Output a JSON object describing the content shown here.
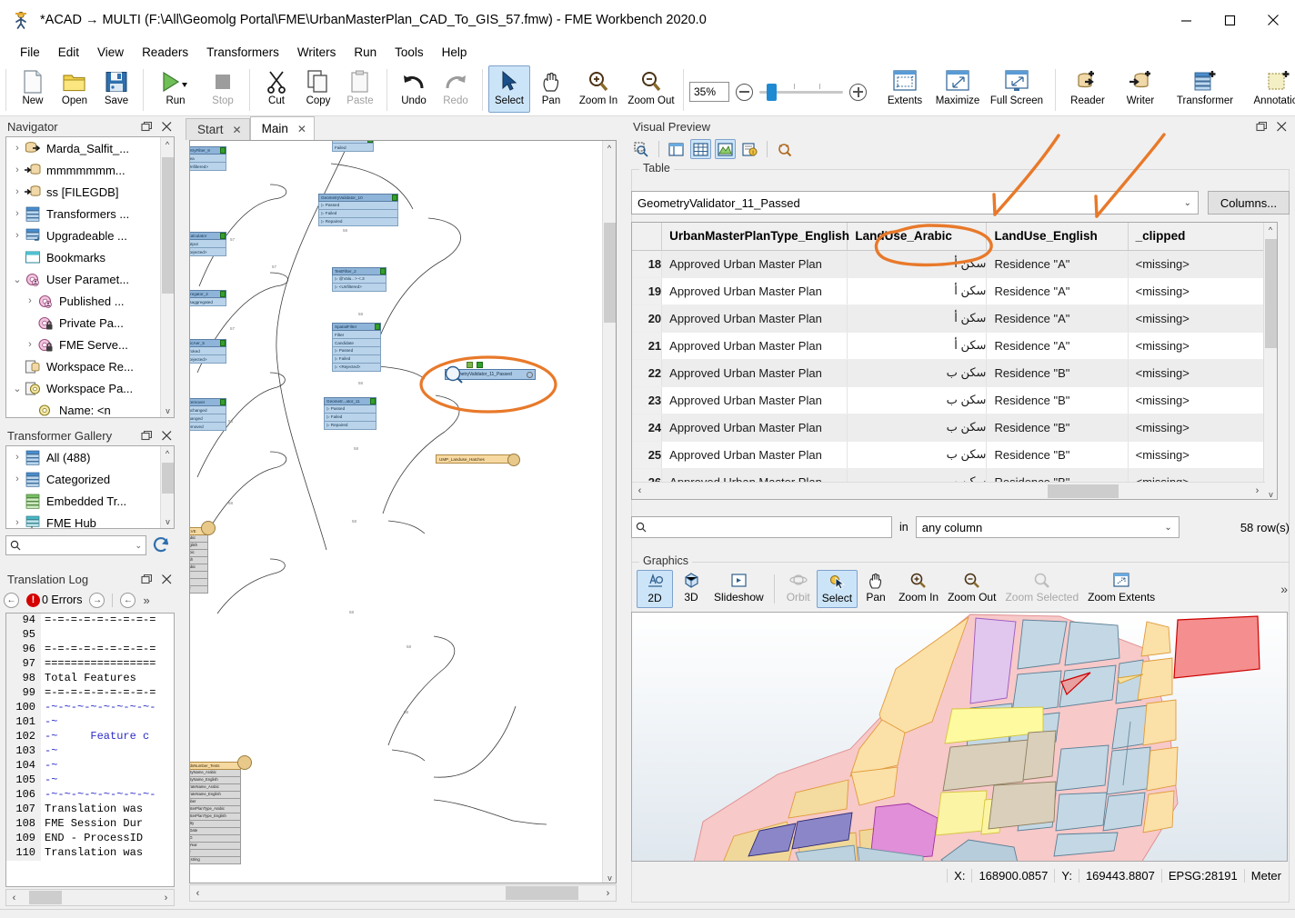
{
  "window": {
    "title": "*ACAD → MULTI (F:\\All\\Geomolg Portal\\FME\\UrbanMasterPlan_CAD_To_GIS_57.fmw) - FME Workbench 2020.0",
    "app_icon": "fme-logo-icon",
    "minimize": "—",
    "maximize": "☐",
    "close": "✕"
  },
  "menu": [
    "File",
    "Edit",
    "View",
    "Readers",
    "Transformers",
    "Writers",
    "Run",
    "Tools",
    "Help"
  ],
  "toolbar": {
    "buttons": [
      {
        "label": "New",
        "icon": "new-document-icon",
        "enabled": true
      },
      {
        "label": "Open",
        "icon": "open-folder-icon",
        "enabled": true
      },
      {
        "label": "Save",
        "icon": "save-disk-icon",
        "enabled": true
      },
      {
        "label": "Run",
        "icon": "run-play-icon",
        "enabled": true
      },
      {
        "label": "Stop",
        "icon": "stop-square-icon",
        "enabled": false
      },
      {
        "label": "Cut",
        "icon": "scissors-icon",
        "enabled": true
      },
      {
        "label": "Copy",
        "icon": "copy-icon",
        "enabled": true
      },
      {
        "label": "Paste",
        "icon": "clipboard-icon",
        "enabled": false
      },
      {
        "label": "Undo",
        "icon": "undo-arrow-icon",
        "enabled": true
      },
      {
        "label": "Redo",
        "icon": "redo-arrow-icon",
        "enabled": false
      },
      {
        "label": "Select",
        "icon": "cursor-arrow-icon",
        "enabled": true,
        "active": true
      },
      {
        "label": "Pan",
        "icon": "hand-icon",
        "enabled": true
      },
      {
        "label": "Zoom In",
        "icon": "zoom-in-icon",
        "enabled": true
      },
      {
        "label": "Zoom Out",
        "icon": "zoom-out-icon",
        "enabled": true
      }
    ],
    "zoom_value": "35%",
    "view_buttons": [
      {
        "label": "Extents",
        "icon": "extents-icon"
      },
      {
        "label": "Maximize",
        "icon": "maximize-view-icon"
      },
      {
        "label": "Full Screen",
        "icon": "full-screen-icon"
      }
    ],
    "add_buttons": [
      {
        "label": "Reader",
        "icon": "add-reader-icon"
      },
      {
        "label": "Writer",
        "icon": "add-writer-icon"
      },
      {
        "label": "Transformer",
        "icon": "add-transformer-icon"
      },
      {
        "label": "Annotation",
        "icon": "add-annotation-icon"
      }
    ],
    "overflow": "»"
  },
  "navigator": {
    "title": "Navigator",
    "float_icon": "float-panel-icon",
    "close_icon": "close-icon",
    "items": [
      {
        "label": "Marda_Salfit_...",
        "icon": "reader-db-icon",
        "expander": ">",
        "indent": 0
      },
      {
        "label": "mmmmmmm...",
        "icon": "writer-db-icon",
        "expander": ">",
        "indent": 0
      },
      {
        "label": "ss [FILEGDB]",
        "icon": "writer-db-icon",
        "expander": ">",
        "indent": 0
      },
      {
        "label": "Transformers ...",
        "icon": "transformer-icon",
        "expander": ">",
        "indent": 0
      },
      {
        "label": "Upgradeable ...",
        "icon": "upgradeable-icon",
        "expander": ">",
        "indent": 0
      },
      {
        "label": "Bookmarks",
        "icon": "bookmark-icon",
        "expander": "",
        "indent": 0
      },
      {
        "label": "User Paramet...",
        "icon": "user-parameter-icon",
        "expander": "v",
        "indent": 0
      },
      {
        "label": "Published ...",
        "icon": "published-parameter-icon",
        "expander": ">",
        "indent": 1
      },
      {
        "label": "Private Pa...",
        "icon": "private-parameter-icon",
        "expander": "",
        "indent": 1
      },
      {
        "label": "FME Serve...",
        "icon": "fme-server-parameter-icon",
        "expander": ">",
        "indent": 1
      },
      {
        "label": "Workspace Re...",
        "icon": "workspace-resources-icon",
        "expander": "",
        "indent": 0
      },
      {
        "label": "Workspace Pa...",
        "icon": "workspace-parameters-icon",
        "expander": "v",
        "indent": 0
      },
      {
        "label": "Name: <n",
        "icon": "parameter-icon",
        "expander": "",
        "indent": 1
      }
    ]
  },
  "gallery": {
    "title": "Transformer Gallery",
    "items": [
      {
        "label": "All (488)",
        "icon": "transformer-icon",
        "expander": ">"
      },
      {
        "label": "Categorized",
        "icon": "transformer-icon",
        "expander": ">"
      },
      {
        "label": "Embedded Tr...",
        "icon": "embedded-transformer-icon",
        "expander": ""
      },
      {
        "label": "FME Hub",
        "icon": "fme-hub-icon",
        "expander": ">"
      }
    ],
    "search_placeholder": "",
    "search_value": "",
    "search_icon": "search-icon",
    "refresh_icon": "refresh-icon"
  },
  "translation_log": {
    "title": "Translation Log",
    "errors_label": "0 Errors",
    "error_icon": "error-icon",
    "prev_icon": "prev-arrow-icon",
    "next_icon": "next-arrow-icon",
    "jump_icon": "jump-arrow-icon",
    "overflow": "»",
    "lines": [
      {
        "no": "94",
        "text": "=-=-=-=-=-=-=-=-=",
        "style": "plain"
      },
      {
        "no": "95",
        "text": "",
        "style": "plain"
      },
      {
        "no": "96",
        "text": "=-=-=-=-=-=-=-=-=",
        "style": "plain"
      },
      {
        "no": "97",
        "text": "=================",
        "style": "plain"
      },
      {
        "no": "98",
        "text": "Total Features",
        "style": "plain"
      },
      {
        "no": "99",
        "text": "=-=-=-=-=-=-=-=-=",
        "style": "plain"
      },
      {
        "no": "100",
        "text": "-~-~-~-~-~-~-~-~-",
        "style": "blue"
      },
      {
        "no": "101",
        "text": "-~",
        "style": "blue"
      },
      {
        "no": "102",
        "text": "-~     Feature c",
        "style": "blue"
      },
      {
        "no": "103",
        "text": "-~",
        "style": "blue"
      },
      {
        "no": "104",
        "text": "-~",
        "style": "blue"
      },
      {
        "no": "105",
        "text": "-~",
        "style": "blue"
      },
      {
        "no": "106",
        "text": "-~-~-~-~-~-~-~-~-",
        "style": "blue"
      },
      {
        "no": "107",
        "text": "Translation was",
        "style": "plain"
      },
      {
        "no": "108",
        "text": "FME Session Dur",
        "style": "plain"
      },
      {
        "no": "109",
        "text": "END - ProcessID",
        "style": "plain"
      },
      {
        "no": "110",
        "text": "Translation was",
        "style": "plain"
      }
    ]
  },
  "canvas": {
    "tabs": [
      {
        "label": "Start",
        "active": false,
        "close": "✕"
      },
      {
        "label": "Main",
        "active": true,
        "close": "✕"
      }
    ],
    "nodes": [
      {
        "name": "metryFilter_9",
        "ports": [
          "Area",
          "<Unfiltered>"
        ]
      },
      {
        "name": "nCalculator",
        "ports": [
          "Output",
          "<Rejected>"
        ]
      },
      {
        "name": "ggregator_2",
        "ports": [
          "Disaggregated"
        ]
      },
      {
        "name": "orticAer_5",
        "ports": [
          "Stroked",
          "<Rejected>"
        ]
      },
      {
        "name": "eRemover",
        "ports": [
          "Unchanged",
          "Changed",
          "Removed"
        ]
      },
      {
        "name": "GeometryValidator_10",
        "ports": [
          "Passed",
          "Failed",
          "Repaired"
        ]
      },
      {
        "name": "TestFilter_2",
        "ports": [
          "@Valu.. > <.3",
          "<Unfiltered>"
        ]
      },
      {
        "name": "SpatialFilter",
        "ports": [
          "Filter",
          "Candidate",
          "Passed",
          "Failed",
          "<Rejected>"
        ]
      },
      {
        "name": "Geometr...ator_11",
        "ports": [
          "Passed",
          "Failed",
          "Repaired"
        ]
      }
    ],
    "selected_node": "GeometryValidator_11_Passed",
    "writer_node": "UMP_Landuse_Hatches",
    "feature_node_top": "...VE",
    "feature_node_top_rows": [
      "rabic",
      "nglish",
      "abic",
      "lish",
      "rabic",
      "r",
      "n",
      "ar"
    ],
    "feature_node_bottom": "adsNumber_Tests",
    "feature_node_bottom_rows": [
      "nityName_Arabic",
      "nityName_English",
      "orateName_Arabic",
      "orateName_English",
      "mber",
      "asterPlanType_Arabic",
      "asterPlanType_English",
      "dBy",
      "dDate",
      "LG",
      "dYear",
      "or",
      "t_string"
    ]
  },
  "preview": {
    "title": "Visual Preview",
    "float_icon": "float-panel-icon",
    "close_icon": "close-icon",
    "toolbar_icons": [
      {
        "name": "inspect-icon",
        "active": false
      },
      {
        "name": "layout-panel-icon",
        "active": false
      },
      {
        "name": "table-view-icon",
        "active": true
      },
      {
        "name": "graphics-view-icon",
        "active": true
      },
      {
        "name": "feature-info-icon",
        "active": false
      },
      {
        "name": "search-magnifier-icon",
        "active": false
      }
    ],
    "table_group_label": "Table",
    "dataset_selected": "GeometryValidator_11_Passed",
    "columns_button": "Columns...",
    "headers": [
      "UrbanMasterPlanType_English",
      "LandUse_Arabic",
      "LandUse_English",
      "_clipped"
    ],
    "rows": [
      {
        "no": "18",
        "c0": "Approved Urban Master Plan",
        "c1": "سكن أ",
        "c2": "Residence \"A\"",
        "c3": "<missing>"
      },
      {
        "no": "19",
        "c0": "Approved Urban Master Plan",
        "c1": "سكن أ",
        "c2": "Residence \"A\"",
        "c3": "<missing>"
      },
      {
        "no": "20",
        "c0": "Approved Urban Master Plan",
        "c1": "سكن أ",
        "c2": "Residence \"A\"",
        "c3": "<missing>"
      },
      {
        "no": "21",
        "c0": "Approved Urban Master Plan",
        "c1": "سكن أ",
        "c2": "Residence \"A\"",
        "c3": "<missing>"
      },
      {
        "no": "22",
        "c0": "Approved Urban Master Plan",
        "c1": "سكن ب",
        "c2": "Residence \"B\"",
        "c3": "<missing>"
      },
      {
        "no": "23",
        "c0": "Approved Urban Master Plan",
        "c1": "سكن ب",
        "c2": "Residence \"B\"",
        "c3": "<missing>"
      },
      {
        "no": "24",
        "c0": "Approved Urban Master Plan",
        "c1": "سكن ب",
        "c2": "Residence \"B\"",
        "c3": "<missing>"
      },
      {
        "no": "25",
        "c0": "Approved Urban Master Plan",
        "c1": "سكن ب",
        "c2": "Residence \"B\"",
        "c3": "<missing>"
      },
      {
        "no": "26",
        "c0": "Approved Urban Master Plan",
        "c1": "سكن ب",
        "c2": "Residence \"B\"",
        "c3": "<missing>"
      }
    ],
    "find_value": "",
    "find_icon": "search-icon",
    "find_in_label": "in",
    "find_column": "any column",
    "row_count": "58 row(s)",
    "graphics_group_label": "Graphics",
    "graphics_buttons": [
      {
        "label": "2D",
        "icon": "view-2d-icon",
        "state": "on"
      },
      {
        "label": "3D",
        "icon": "view-3d-icon",
        "state": "normal"
      },
      {
        "label": "Slideshow",
        "icon": "slideshow-icon",
        "state": "normal"
      },
      {
        "label": "Orbit",
        "icon": "orbit-icon",
        "state": "off"
      },
      {
        "label": "Select",
        "icon": "cursor-arrow-icon",
        "state": "on"
      },
      {
        "label": "Pan",
        "icon": "hand-icon",
        "state": "normal"
      },
      {
        "label": "Zoom In",
        "icon": "zoom-in-icon",
        "state": "normal"
      },
      {
        "label": "Zoom Out",
        "icon": "zoom-out-icon",
        "state": "normal"
      },
      {
        "label": "Zoom Selected",
        "icon": "zoom-selected-icon",
        "state": "off"
      },
      {
        "label": "Zoom Extents",
        "icon": "zoom-extents-icon",
        "state": "normal"
      }
    ],
    "graphics_overflow": "»",
    "status": {
      "x_label": "X:",
      "x_value": "168900.0857",
      "y_label": "Y:",
      "y_value": "169443.8807",
      "epsg": "EPSG:28191",
      "units": "Meter"
    }
  },
  "annotation_color": "#e8792a",
  "colors": {
    "accent": "#cce4f7",
    "accent_border": "#7da2ce",
    "node_header": "#8fb4d9",
    "node_port": "#b9d3ea",
    "writer": "#f6d9a0"
  }
}
